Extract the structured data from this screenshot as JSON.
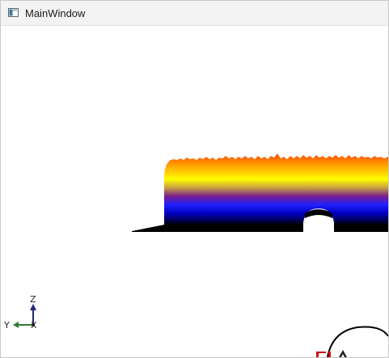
{
  "window": {
    "title": "MainWindow"
  },
  "icons": {
    "app": "window-app-icon"
  },
  "axes_gizmo": {
    "z_label": "Z",
    "y_label": "Y",
    "x_label": "X",
    "colors": {
      "z": "#1f2a7a",
      "y": "#2e7d32",
      "x": "#1a1a1a"
    }
  },
  "surface": {
    "gradient_colors": [
      "#ff4500",
      "#ff8c00",
      "#ffd700",
      "#ffff00",
      "#800080",
      "#0000ff",
      "#0000a0",
      "#000000"
    ]
  }
}
